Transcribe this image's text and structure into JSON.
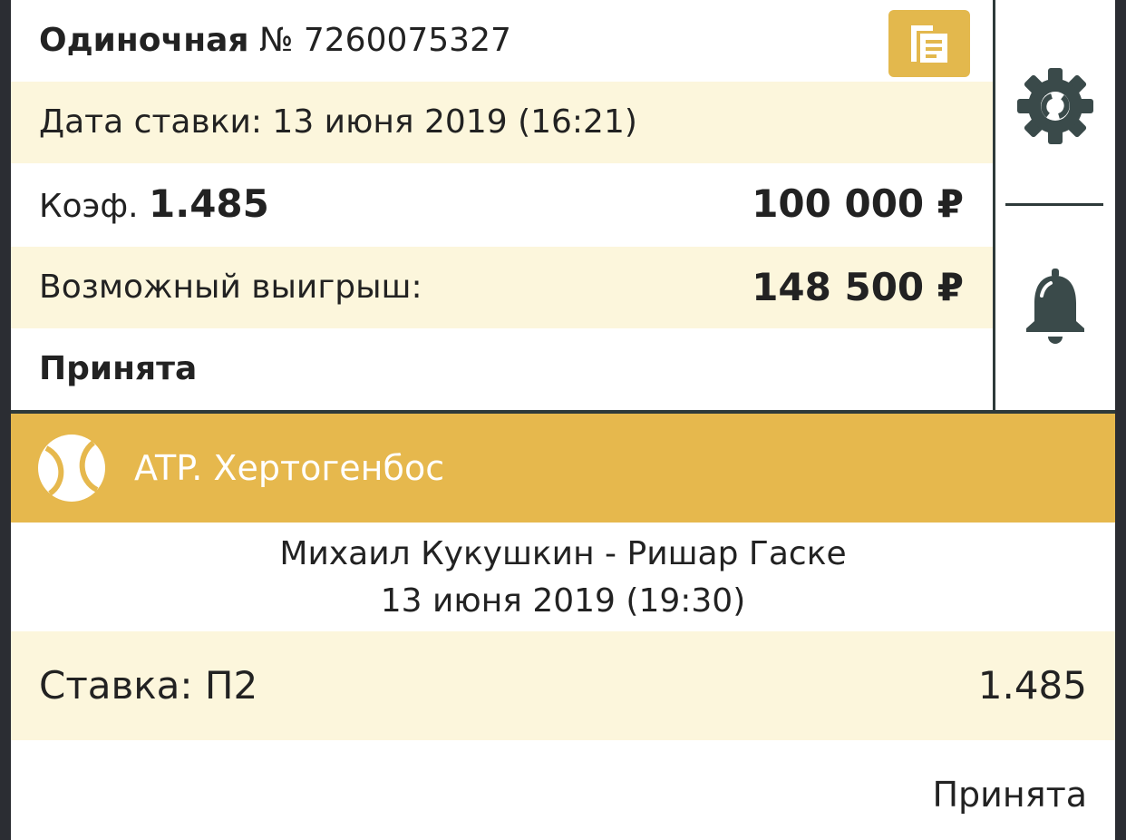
{
  "bet": {
    "type": "Одиночная",
    "number": "№ 7260075327",
    "date_label": "Дата ставки: 13 июня 2019 (16:21)",
    "coef_label": "Коэф.",
    "coef_value": "1.485",
    "amount": "100 000 ₽",
    "win_label": "Возможный выигрыш:",
    "win_value": "148 500 ₽",
    "status": "Принята"
  },
  "icons": {
    "copy": "copy-icon",
    "settings": "gear-icon",
    "notify": "bell-icon",
    "sport": "tennis-ball-icon"
  },
  "event": {
    "tournament": "ATP. Хертогенбос",
    "match": "Михаил Кукушкин - Ришар Гаске",
    "date": "13 июня 2019 (19:30)",
    "stake_label": "Ставка: П2",
    "stake_coef": "1.485",
    "status": "Принята"
  },
  "colors": {
    "accent": "#e6b84d",
    "cream": "#fcf6dc",
    "icon_dark": "#3a4a4a",
    "text": "#222222"
  }
}
